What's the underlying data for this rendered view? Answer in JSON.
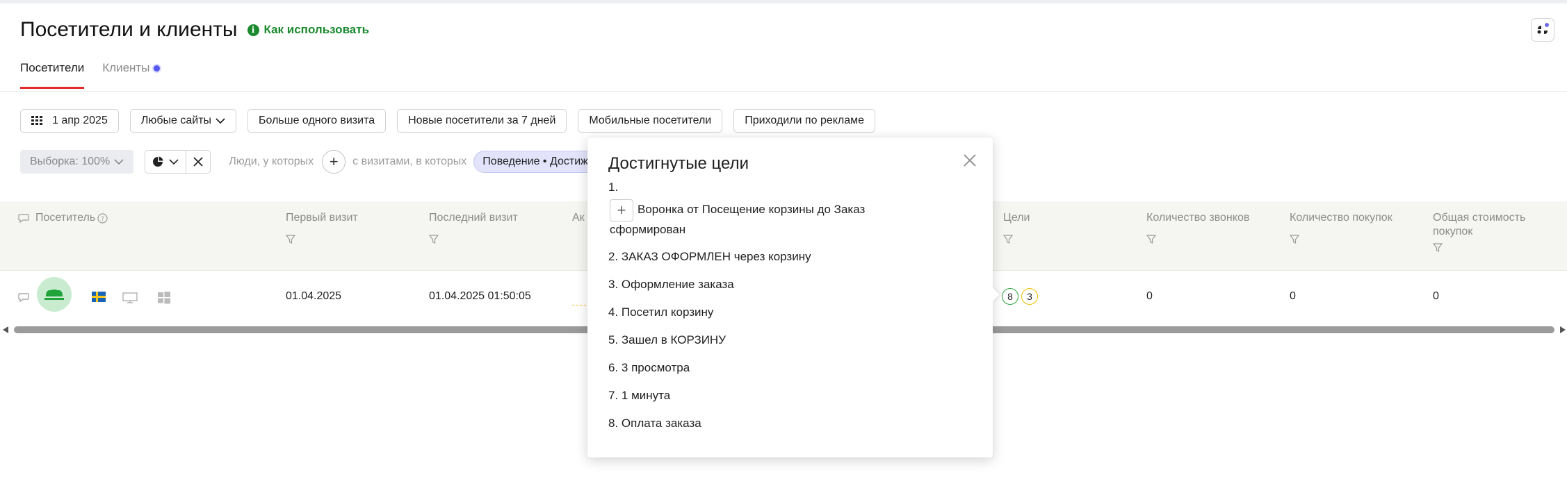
{
  "header": {
    "title": "Посетители и клиенты",
    "help_label": "Как использовать",
    "help_icon": "info-icon"
  },
  "tabs": [
    {
      "label": "Посетители",
      "active": true
    },
    {
      "label": "Клиенты",
      "active": false
    }
  ],
  "filters": {
    "date": "1 апр 2025",
    "sites": "Любые сайты",
    "more_than_one_visit": "Больше одного визита",
    "new_visitors": "Новые посетители за 7 дней",
    "mobile": "Мобильные посетители",
    "ads": "Приходили по рекламе"
  },
  "segment": {
    "sample": "Выборка: 100%",
    "people_label": "Люди, у которых",
    "visits_label": "с визитами, в которых",
    "condition": "Поведение • Достиж"
  },
  "table": {
    "columns": {
      "visitor": "Посетитель",
      "first_visit": "Первый визит",
      "last_visit": "Последний визит",
      "activity": "Ак",
      "goals": "Цели",
      "calls": "Количество звонков",
      "purchases": "Количество покупок",
      "total_cost": "Общая стоимость покупок"
    },
    "rows": [
      {
        "first_visit": "01.04.2025",
        "last_visit": "01.04.2025 01:50:05",
        "goals_reached": "8",
        "goals_other": "3",
        "calls": "0",
        "purchases": "0",
        "total_cost": "0"
      }
    ]
  },
  "popup": {
    "title": "Достигнутые цели",
    "first_index": "1.",
    "funnel_label": "Воронка от Посещение корзины до Заказ",
    "funnel_label_cont": "сформирован",
    "goals": [
      "2. ЗАКАЗ ОФОРМЛЕН через корзину",
      "3. Оформление заказа",
      "4. Посетил корзину",
      "5. Зашел в КОРЗИНУ",
      "6. 3 просмотра",
      "7. 1 минута",
      "8. Оплата заказа"
    ]
  },
  "colors": {
    "accent_red": "#e52b2b",
    "link_green": "#1a8a2e",
    "chip_purple": "#e3e4fb",
    "badge_green": "#2aa23f",
    "badge_yellow": "#f0c000"
  }
}
